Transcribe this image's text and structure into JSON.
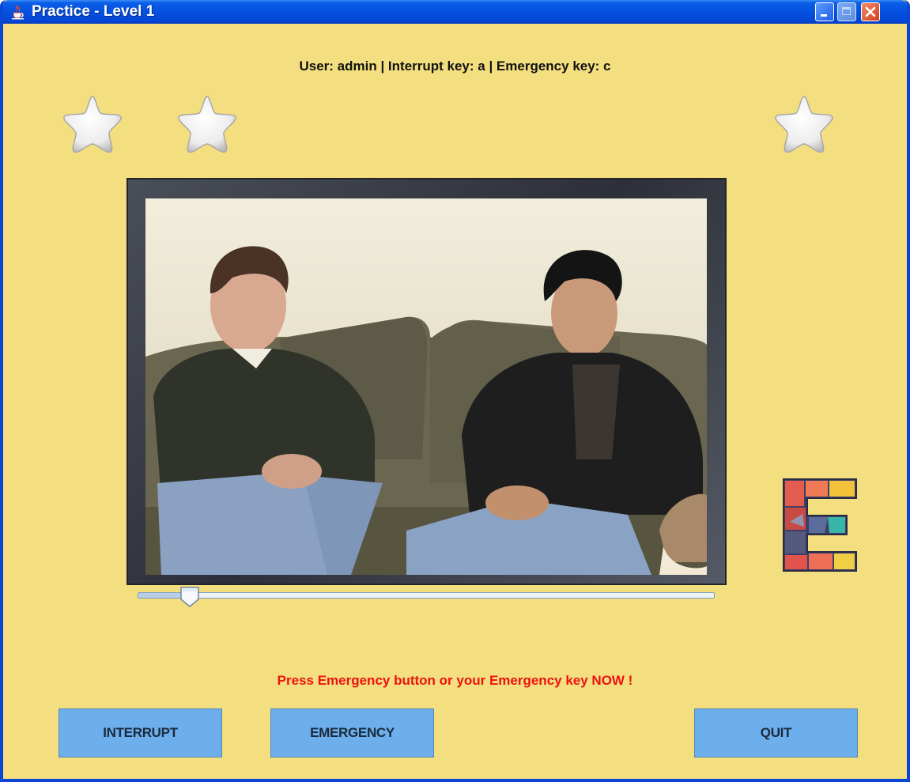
{
  "window": {
    "title": "Practice - Level 1",
    "icon": "java-cup-icon",
    "controls": [
      "minimize-icon",
      "maximize-icon",
      "close-icon"
    ]
  },
  "header": {
    "status_line": "User: admin | Interrupt key: a | Emergency key: c"
  },
  "stars": {
    "count_shown": 3,
    "icon": "star-icon"
  },
  "video": {
    "description_icon": "video-frame",
    "progress": 0.09
  },
  "score_letter": {
    "letter": "E",
    "icon": "mosaic-letter-e-icon"
  },
  "alert": {
    "message": "Press Emergency button or your Emergency key NOW !",
    "color": "#ee1111"
  },
  "buttons": {
    "interrupt": "INTERRUPT",
    "emergency": "EMERGENCY",
    "quit": "QUIT"
  },
  "colors": {
    "background": "#f3df7f",
    "button": "#6daeed",
    "titlebar": "#0551e0"
  }
}
